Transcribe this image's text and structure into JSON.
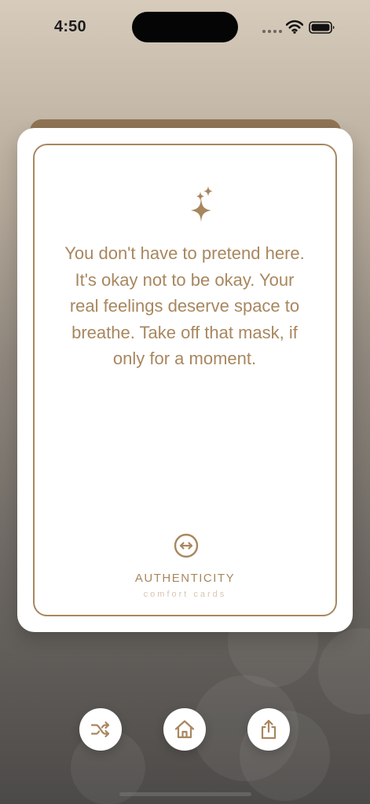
{
  "status_bar": {
    "time": "4:50",
    "icons": [
      "cellular-signal-icon",
      "wifi-icon",
      "battery-icon"
    ]
  },
  "card": {
    "top_icon": "sparkles-icon",
    "message": "You don't have to pretend here. It's okay not to be okay. Your real feelings deserve space to breathe. Take off that mask, if only for a moment.",
    "category_icon": "left-right-arrow-circle-icon",
    "category": "AUTHENTICITY",
    "brand": "comfort cards"
  },
  "actions": [
    {
      "name": "shuffle",
      "icon": "shuffle-icon"
    },
    {
      "name": "home",
      "icon": "home-icon"
    },
    {
      "name": "share",
      "icon": "share-icon"
    }
  ],
  "colors": {
    "accent": "#a8875f",
    "card_background": "#ffffff",
    "card_edge": "#8a6d4b",
    "brand_text": "#d8c6b2"
  }
}
